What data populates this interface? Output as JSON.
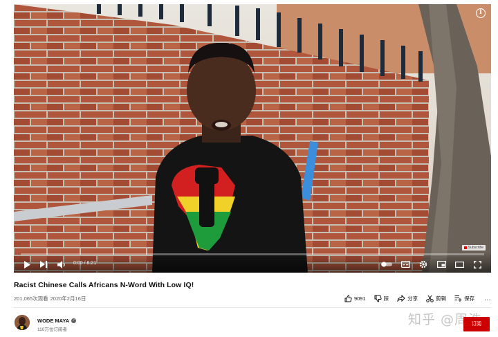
{
  "video": {
    "title": "Racist Chinese Calls Africans N-Word With Low IQ!",
    "views": "201,065次观看",
    "date": "2020年2月16日",
    "progress_fraction": 0.0
  },
  "player": {
    "info_icon": "info-icon",
    "watermark_label": "Subscribe",
    "time_current": "0:00",
    "time_separator": " / ",
    "time_total": "8:21",
    "controls": [
      "play-icon",
      "next-icon",
      "volume-icon",
      "autoplay-toggle-icon",
      "subtitles-icon",
      "settings-icon",
      "miniplayer-icon",
      "theater-icon",
      "fullscreen-icon"
    ]
  },
  "actions": {
    "like_count": "9091",
    "dislike_label": "踩",
    "share_label": "分享",
    "clip_label": "剪辑",
    "save_label": "保存",
    "more_label": "..."
  },
  "channel": {
    "name": "WODE MAYA",
    "subscribers": "110万位订阅者",
    "subscribe_label": "订阅"
  },
  "watermark": {
    "text": "知乎 @周浩"
  },
  "colors": {
    "accent": "#ff0000",
    "subscribe": "#cc0000",
    "text_secondary": "#606060"
  }
}
